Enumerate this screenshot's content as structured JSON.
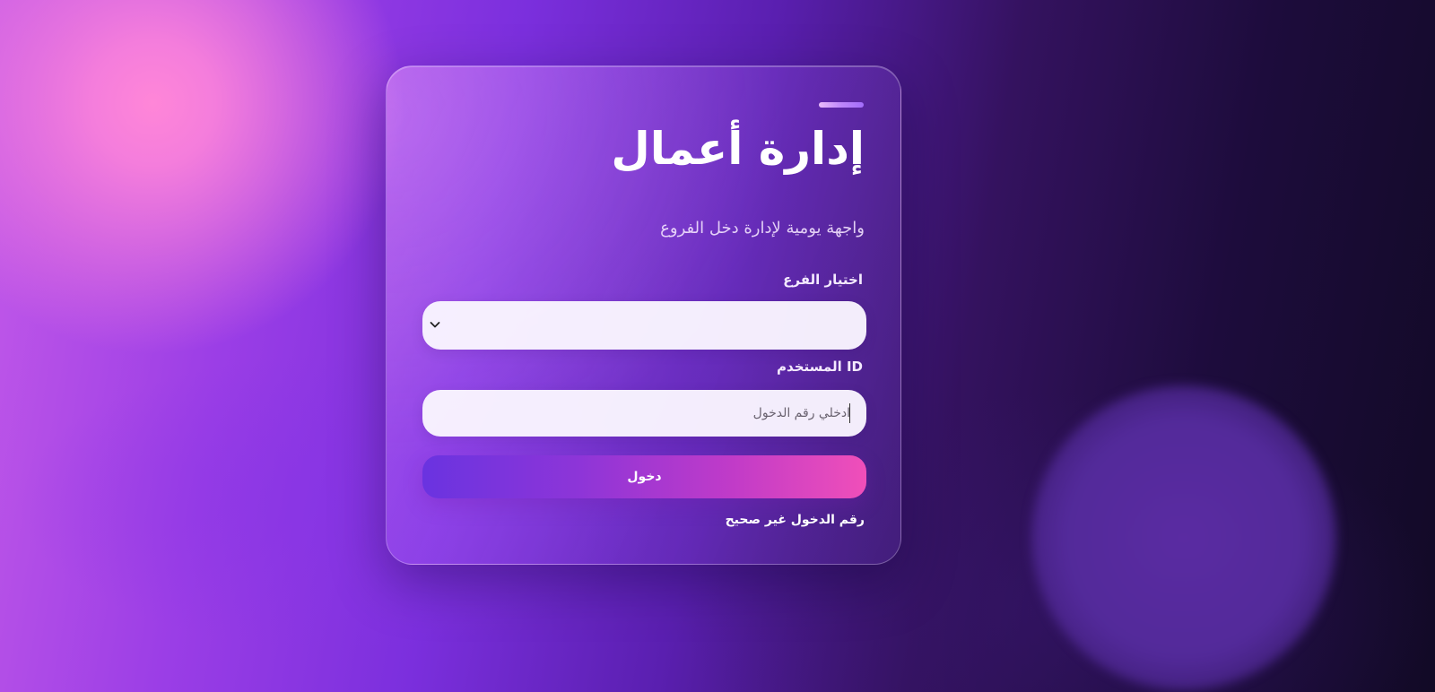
{
  "brand": {
    "title": "إدارة أعمال",
    "subtitle": "واجهة يومية لإدارة دخل الفروع"
  },
  "form": {
    "branch_label": "اختيار الفرع",
    "branch_selected": "",
    "user_id_label": "ID المستخدم",
    "user_id_placeholder": "ادخلي رقم الدخول",
    "user_id_value": "",
    "submit_label": "دخول",
    "error_message": "رقم الدخول غير صحيح"
  },
  "icons": {
    "select_icon": "chevron-down-icon"
  },
  "colors": {
    "button_gradient_start": "#6a33e0",
    "button_gradient_end": "#f04fb9",
    "background_dark": "#120a26",
    "background_pink": "#ff86d8"
  }
}
